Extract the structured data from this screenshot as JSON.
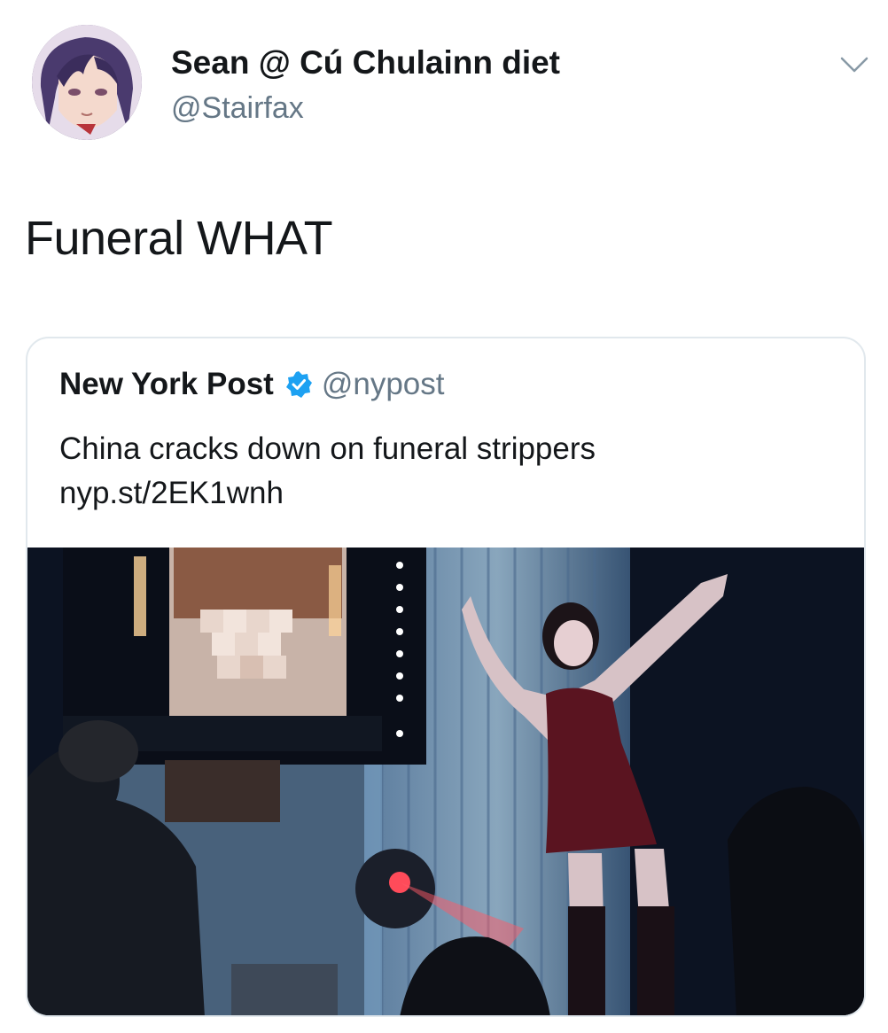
{
  "author": {
    "display_name": "Sean @ Cú Chulainn diet",
    "handle": "@Stairfax",
    "avatar_icon": "anime-avatar"
  },
  "menu_icon": "chevron-down-icon",
  "tweet_text": "Funeral WHAT",
  "quoted_tweet": {
    "display_name": "New York Post",
    "verified": true,
    "handle": "@nypost",
    "text": "China cracks down on funeral strippers",
    "link": "nyp.st/2EK1wnh",
    "photo_icon": "funeral-stage-photo"
  },
  "colors": {
    "text": "#14171a",
    "secondary": "#657786",
    "verified_blue": "#1da1f2",
    "card_border": "#e1e8ed"
  }
}
